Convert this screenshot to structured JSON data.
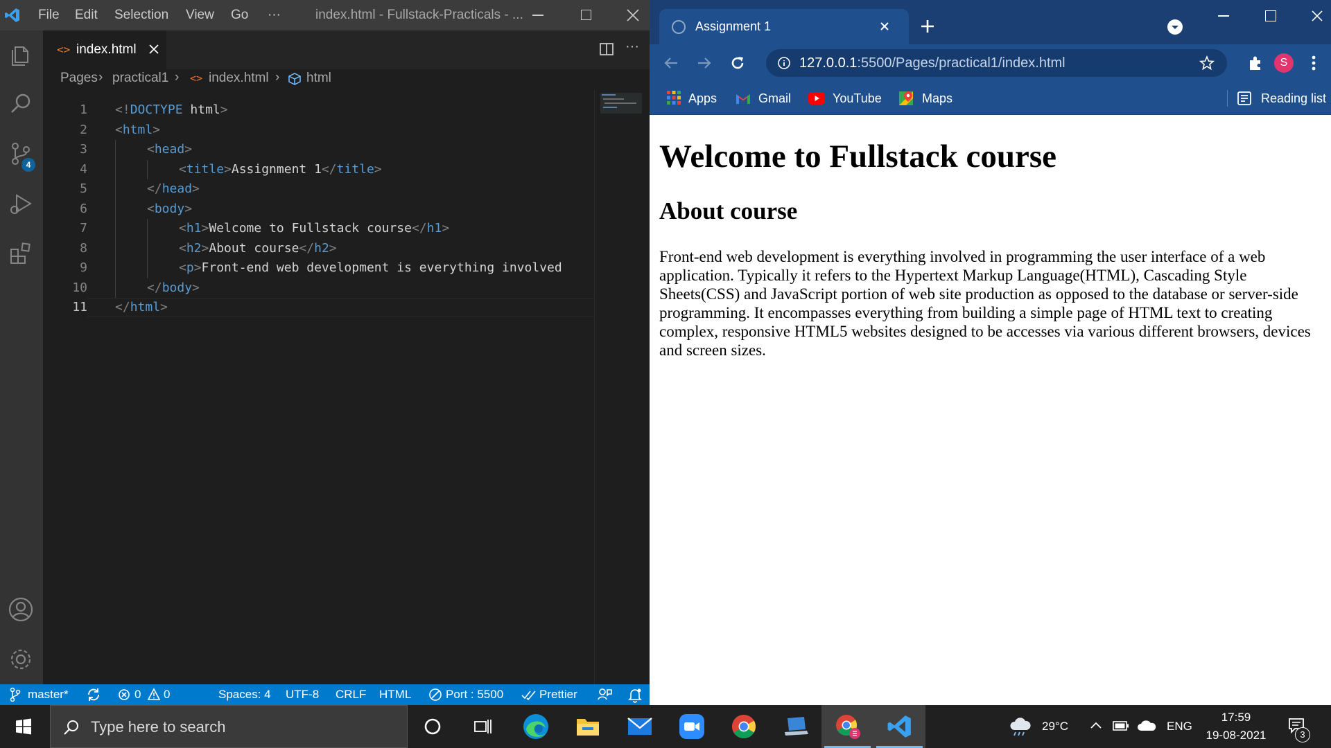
{
  "vscode": {
    "menu": [
      "File",
      "Edit",
      "Selection",
      "View",
      "Go",
      "···"
    ],
    "window_title": "index.html - Fullstack-Practicals - ...",
    "source_control_badge": "4",
    "tab": {
      "label": "index.html"
    },
    "breadcrumb": [
      "Pages",
      "practical1",
      "index.html",
      "html"
    ],
    "code_lines": [
      {
        "num": "1",
        "indent": 0,
        "parts": [
          [
            "p",
            "<!"
          ],
          [
            "t",
            "DOCTYPE "
          ],
          [
            "tx",
            "html"
          ],
          [
            "p",
            ">"
          ]
        ]
      },
      {
        "num": "2",
        "indent": 0,
        "parts": [
          [
            "p",
            "<"
          ],
          [
            "t",
            "html"
          ],
          [
            "p",
            ">"
          ]
        ]
      },
      {
        "num": "3",
        "indent": 1,
        "parts": [
          [
            "p",
            "<"
          ],
          [
            "t",
            "head"
          ],
          [
            "p",
            ">"
          ]
        ]
      },
      {
        "num": "4",
        "indent": 2,
        "parts": [
          [
            "p",
            "<"
          ],
          [
            "t",
            "title"
          ],
          [
            "p",
            ">"
          ],
          [
            "tx",
            "Assignment 1"
          ],
          [
            "p",
            "</"
          ],
          [
            "t",
            "title"
          ],
          [
            "p",
            ">"
          ]
        ]
      },
      {
        "num": "5",
        "indent": 1,
        "parts": [
          [
            "p",
            "</"
          ],
          [
            "t",
            "head"
          ],
          [
            "p",
            ">"
          ]
        ]
      },
      {
        "num": "6",
        "indent": 1,
        "parts": [
          [
            "p",
            "<"
          ],
          [
            "t",
            "body"
          ],
          [
            "p",
            ">"
          ]
        ]
      },
      {
        "num": "7",
        "indent": 2,
        "parts": [
          [
            "p",
            "<"
          ],
          [
            "t",
            "h1"
          ],
          [
            "p",
            ">"
          ],
          [
            "tx",
            "Welcome to Fullstack course"
          ],
          [
            "p",
            "</"
          ],
          [
            "t",
            "h1"
          ],
          [
            "p",
            ">"
          ]
        ]
      },
      {
        "num": "8",
        "indent": 2,
        "parts": [
          [
            "p",
            "<"
          ],
          [
            "t",
            "h2"
          ],
          [
            "p",
            ">"
          ],
          [
            "tx",
            "About course"
          ],
          [
            "p",
            "</"
          ],
          [
            "t",
            "h2"
          ],
          [
            "p",
            ">"
          ]
        ]
      },
      {
        "num": "9",
        "indent": 2,
        "parts": [
          [
            "p",
            "<"
          ],
          [
            "t",
            "p"
          ],
          [
            "p",
            ">"
          ],
          [
            "tx",
            "Front-end web development is everything involved"
          ]
        ]
      },
      {
        "num": "10",
        "indent": 1,
        "parts": [
          [
            "p",
            "</"
          ],
          [
            "t",
            "body"
          ],
          [
            "p",
            ">"
          ]
        ]
      },
      {
        "num": "11",
        "indent": 0,
        "parts": [
          [
            "p",
            "</"
          ],
          [
            "t",
            "html"
          ],
          [
            "p",
            ">"
          ]
        ]
      }
    ],
    "status": {
      "branch": "master*",
      "errors": "0",
      "warnings": "0",
      "spaces": "Spaces: 4",
      "encoding": "UTF-8",
      "eol": "CRLF",
      "language": "HTML",
      "port": "Port : 5500",
      "prettier": "Prettier"
    }
  },
  "chrome": {
    "tab_title": "Assignment 1",
    "profile_initial": "S",
    "url_host": "127.0.0.1",
    "url_path": ":5500/Pages/practical1/index.html",
    "bookmarks": [
      "Apps",
      "Gmail",
      "YouTube",
      "Maps"
    ],
    "reading_list": "Reading list",
    "page": {
      "h1": "Welcome to Fullstack course",
      "h2": "About course",
      "paragraph": "Front-end web development is everything involved in programming the user interface of a web application. Typically it refers to the Hypertext Markup Language(HTML), Cascading Style Sheets(CSS) and JavaScript portion of web site production as opposed to the database or server-side programming. It encompasses everything from building a simple page of HTML text to creating complex, responsive HTML5 websites designed to be accesses via various different browsers, devices and screen sizes."
    }
  },
  "taskbar": {
    "search_placeholder": "Type here to search",
    "temperature": "29°C",
    "language": "ENG",
    "time": "17:59",
    "date": "19-08-2021",
    "notification_count": "3"
  }
}
